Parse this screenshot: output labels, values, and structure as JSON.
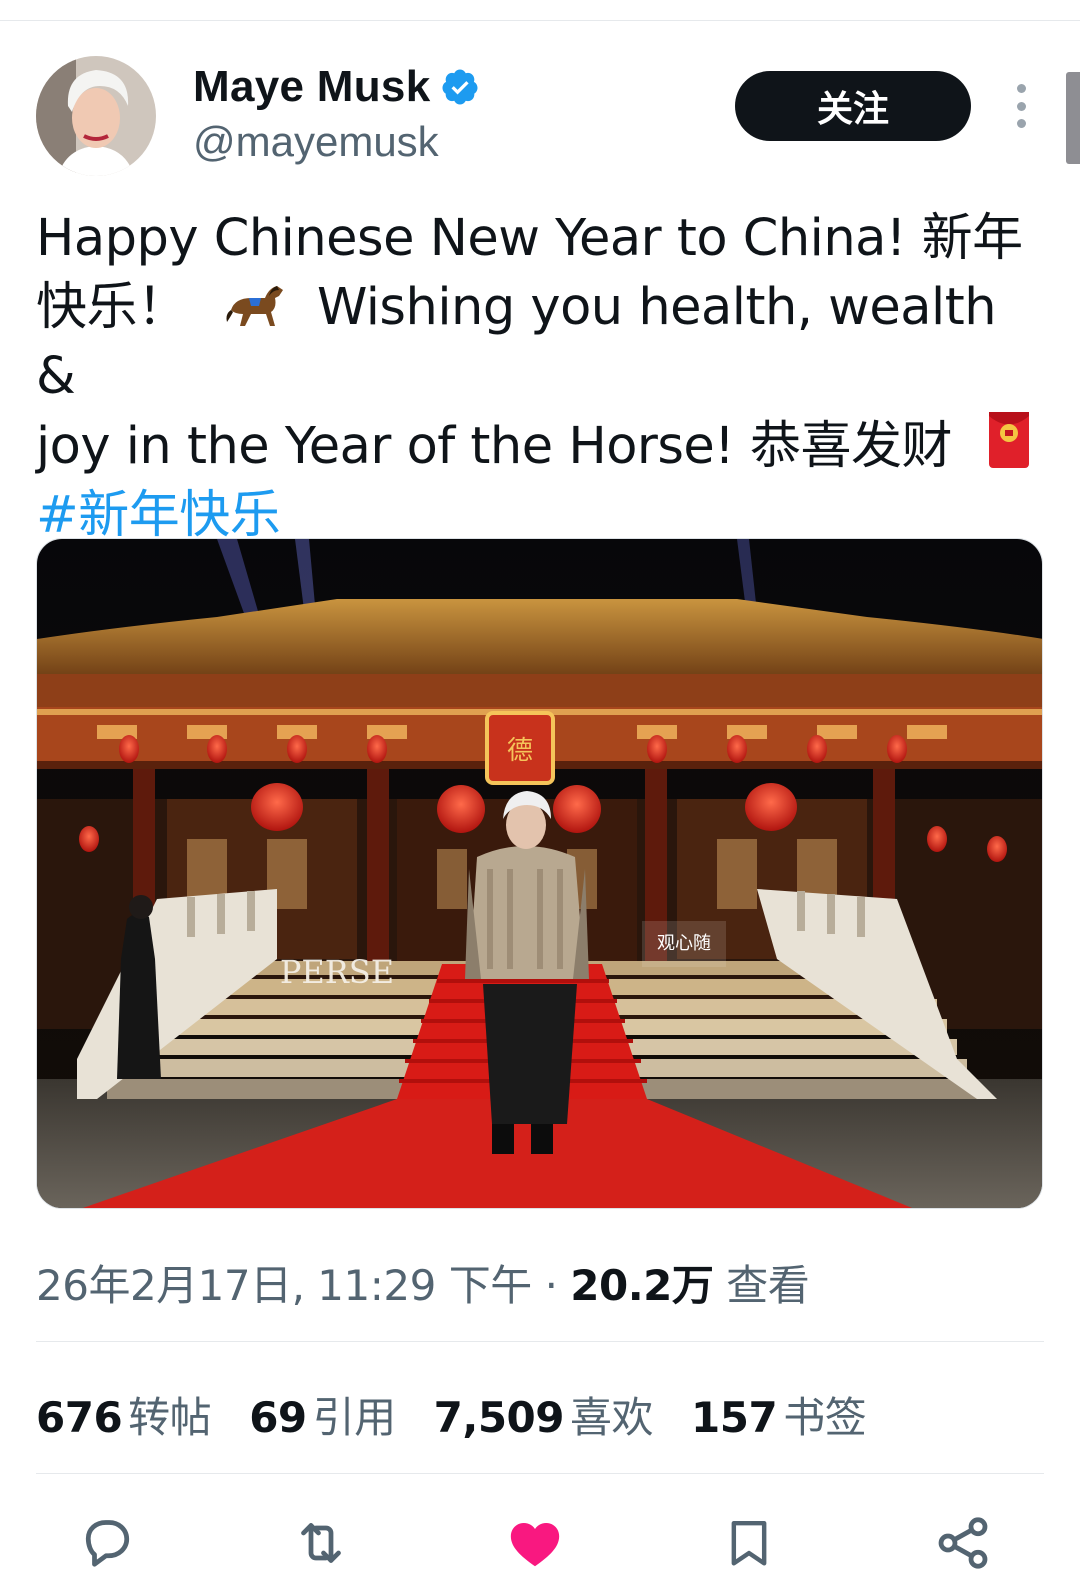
{
  "author": {
    "name": "Maye Musk",
    "handle": "@mayemusk"
  },
  "follow_label": "关注",
  "tweet": {
    "line1": "Happy Chinese New Year to China! 新年",
    "line2a": "快乐！",
    "line2b": "Wishing you health, wealth &",
    "line3": "joy in the Year of the Horse! 恭喜发财",
    "hashtag": "#新年快乐",
    "emoji_horse": "horse-emoji",
    "emoji_envelope": "red-envelope-emoji"
  },
  "image": {
    "sign_left": "PERSE",
    "sign_right": "观心随",
    "plaque": "德"
  },
  "meta": {
    "time": "26年2月17日, 11:29 下午",
    "separator": "·",
    "views": "20.2万",
    "views_label": "查看"
  },
  "stats": [
    {
      "count": "676",
      "label": "转帖"
    },
    {
      "count": "69",
      "label": "引用"
    },
    {
      "count": "7,509",
      "label": "喜欢"
    },
    {
      "count": "157",
      "label": "书签"
    }
  ],
  "colors": {
    "accent": "#1d9bf0",
    "like": "#f91880",
    "text": "#0f1419",
    "secondary": "#536471"
  },
  "icons": [
    "reply-icon",
    "retweet-icon",
    "like-icon",
    "bookmark-icon",
    "share-icon"
  ]
}
